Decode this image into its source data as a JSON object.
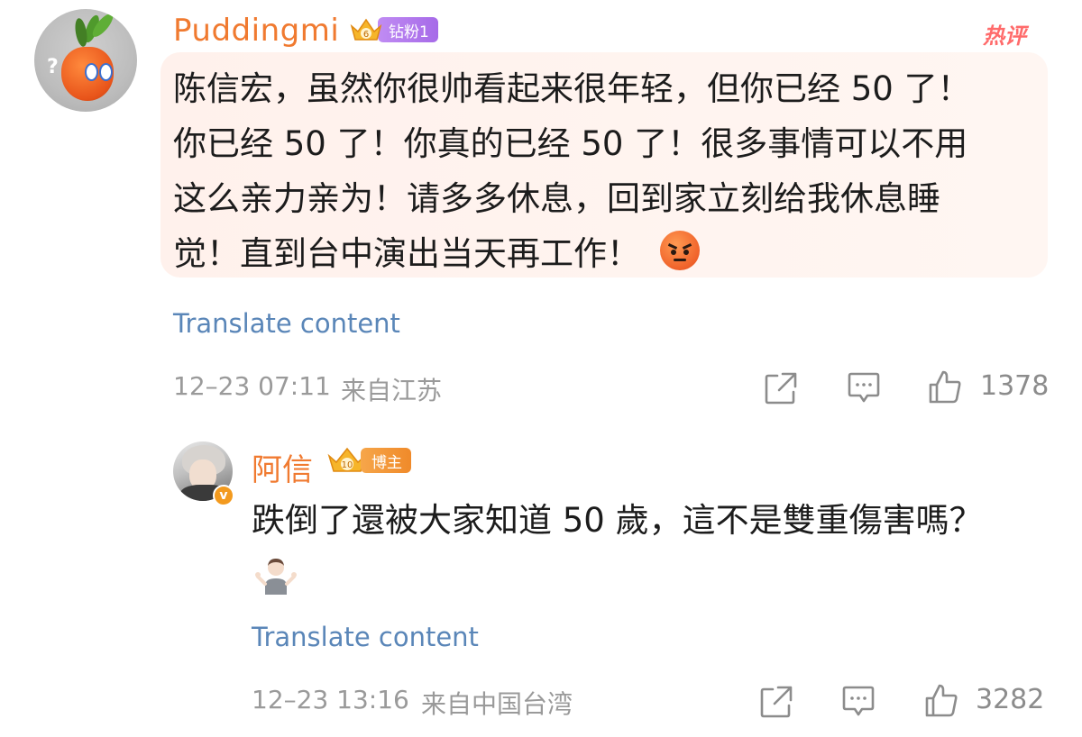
{
  "comment": {
    "username": "Puddingmi",
    "badge_level": "6",
    "badge_label": "钻粉1",
    "hot_tag": "热评",
    "text_lines": [
      "陈信宏，虽然你很帅看起来很年轻，但你已经 50 了！",
      "你已经 50 了！你真的已经 50 了！很多事情可以不用",
      "这么亲力亲为！请多多休息，回到家立刻给我休息睡",
      "觉！直到台中演出当天再工作！"
    ],
    "emoji": "angry-face",
    "translate_label": "Translate content",
    "date": "12–23 07:11",
    "location": "来自江苏",
    "like_count": "1378"
  },
  "reply": {
    "username": "阿信",
    "badge_level": "10",
    "badge_label": "博主",
    "verify_mark": "v",
    "text": "跌倒了還被大家知道 50 歲，這不是雙重傷害嗎？",
    "emoji": "person-shrugging",
    "translate_label": "Translate content",
    "date": "12–23 13:16",
    "location": "来自中国台湾",
    "like_count": "3282"
  },
  "colors": {
    "username": "#f07a30",
    "link": "#5a86b8",
    "meta": "#9a9a9a",
    "bubble": "#fff2ed",
    "hot_tag": "#ff6b6b"
  },
  "icons": [
    "share-icon",
    "comment-icon",
    "like-icon"
  ]
}
